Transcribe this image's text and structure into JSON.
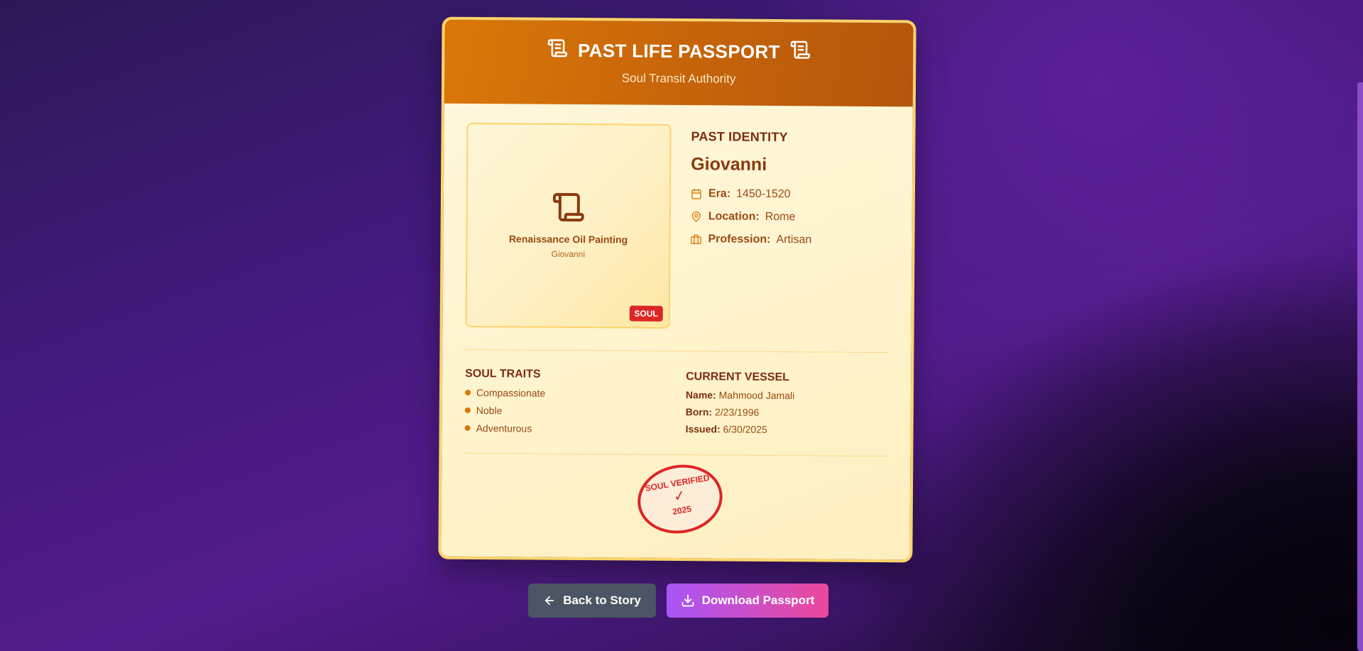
{
  "passport": {
    "title": "PAST LIFE PASSPORT",
    "subtitle": "Soul Transit Authority",
    "header_icon": "scroll-icon",
    "photo": {
      "icon": "scroll-icon",
      "caption": "Renaissance Oil Painting",
      "name": "Giovanni",
      "badge": "SOUL"
    },
    "identity": {
      "label": "PAST IDENTITY",
      "name": "Giovanni",
      "era_label": "Era:",
      "era_value": "1450-1520",
      "location_label": "Location:",
      "location_value": "Rome",
      "profession_label": "Profession:",
      "profession_value": "Artisan"
    },
    "traits": {
      "title": "SOUL TRAITS",
      "items": [
        "Compassionate",
        "Noble",
        "Adventurous"
      ]
    },
    "vessel": {
      "title": "CURRENT VESSEL",
      "name_label": "Name:",
      "name_value": "Mahmood Jamali",
      "born_label": "Born:",
      "born_value": "2/23/1996",
      "issued_label": "Issued:",
      "issued_value": "6/30/2025"
    },
    "stamp": {
      "top": "SOUL VERIFIED",
      "check": "✓",
      "year": "2025"
    }
  },
  "actions": {
    "back_label": "Back to Story",
    "download_label": "Download Passport"
  },
  "colors": {
    "header_orange": "#d97706",
    "stamp_red": "#dc2626",
    "download_gradient_start": "#a855f7",
    "download_gradient_end": "#ec4899",
    "back_button": "#4b5563"
  }
}
